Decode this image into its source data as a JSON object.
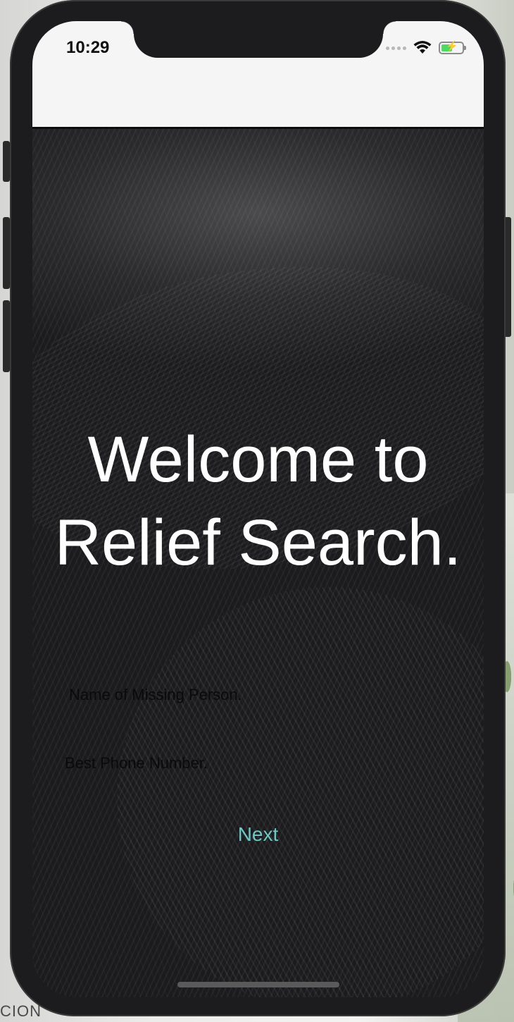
{
  "status_bar": {
    "time": "10:29",
    "wifi_icon": "wifi-icon",
    "battery_icon": "battery-charging-icon",
    "battery_level": 0.55
  },
  "main": {
    "title": "Welcome to Relief Search.",
    "name_placeholder": "Name of Missing Person.",
    "phone_placeholder": "Best Phone Number.",
    "next_label": "Next"
  },
  "backdrop": {
    "partial_text": "CION"
  },
  "colors": {
    "accent": "#6dc7c4",
    "battery_fill": "#4cd964",
    "status_bg": "#f5f5f5",
    "content_bg": "#1a1a1c"
  }
}
